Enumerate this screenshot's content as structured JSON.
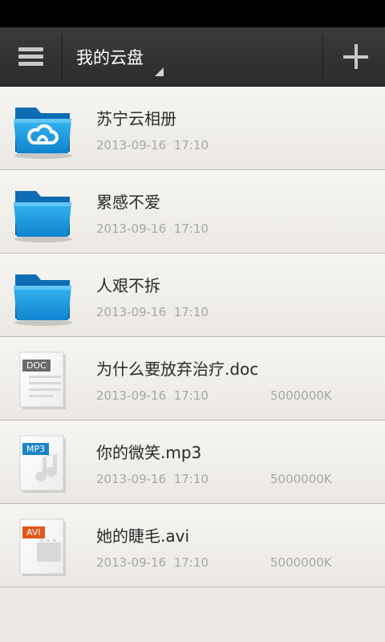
{
  "header": {
    "title": "我的云盘"
  },
  "files": [
    {
      "kind": "folder-cloud",
      "name": "苏宁云相册",
      "date": "2013-09-16  17:10",
      "size": ""
    },
    {
      "kind": "folder",
      "name": "累感不爱",
      "date": "2013-09-16  17:10",
      "size": ""
    },
    {
      "kind": "folder",
      "name": "人艰不拆",
      "date": "2013-09-16  17:10",
      "size": ""
    },
    {
      "kind": "doc",
      "badge": "DOC",
      "name": "为什么要放弃治疗.doc",
      "date": "2013-09-16  17:10",
      "size": "5000000K"
    },
    {
      "kind": "mp3",
      "badge": "MP3",
      "name": "你的微笑.mp3",
      "date": "2013-09-16  17:10",
      "size": "5000000K"
    },
    {
      "kind": "avi",
      "badge": "AVI",
      "name": "她的睫毛.avi",
      "date": "2013-09-16  17:10",
      "size": "5000000K"
    }
  ],
  "colors": {
    "folder": "#1a8fd6",
    "doc_badge": "#6b6b6b",
    "mp3_badge": "#1c84c6",
    "avi_badge": "#e0571b"
  },
  "icons": {
    "menu": "hamburger-menu-icon",
    "add": "plus-icon",
    "dropdown": "dropdown-caret-icon"
  }
}
